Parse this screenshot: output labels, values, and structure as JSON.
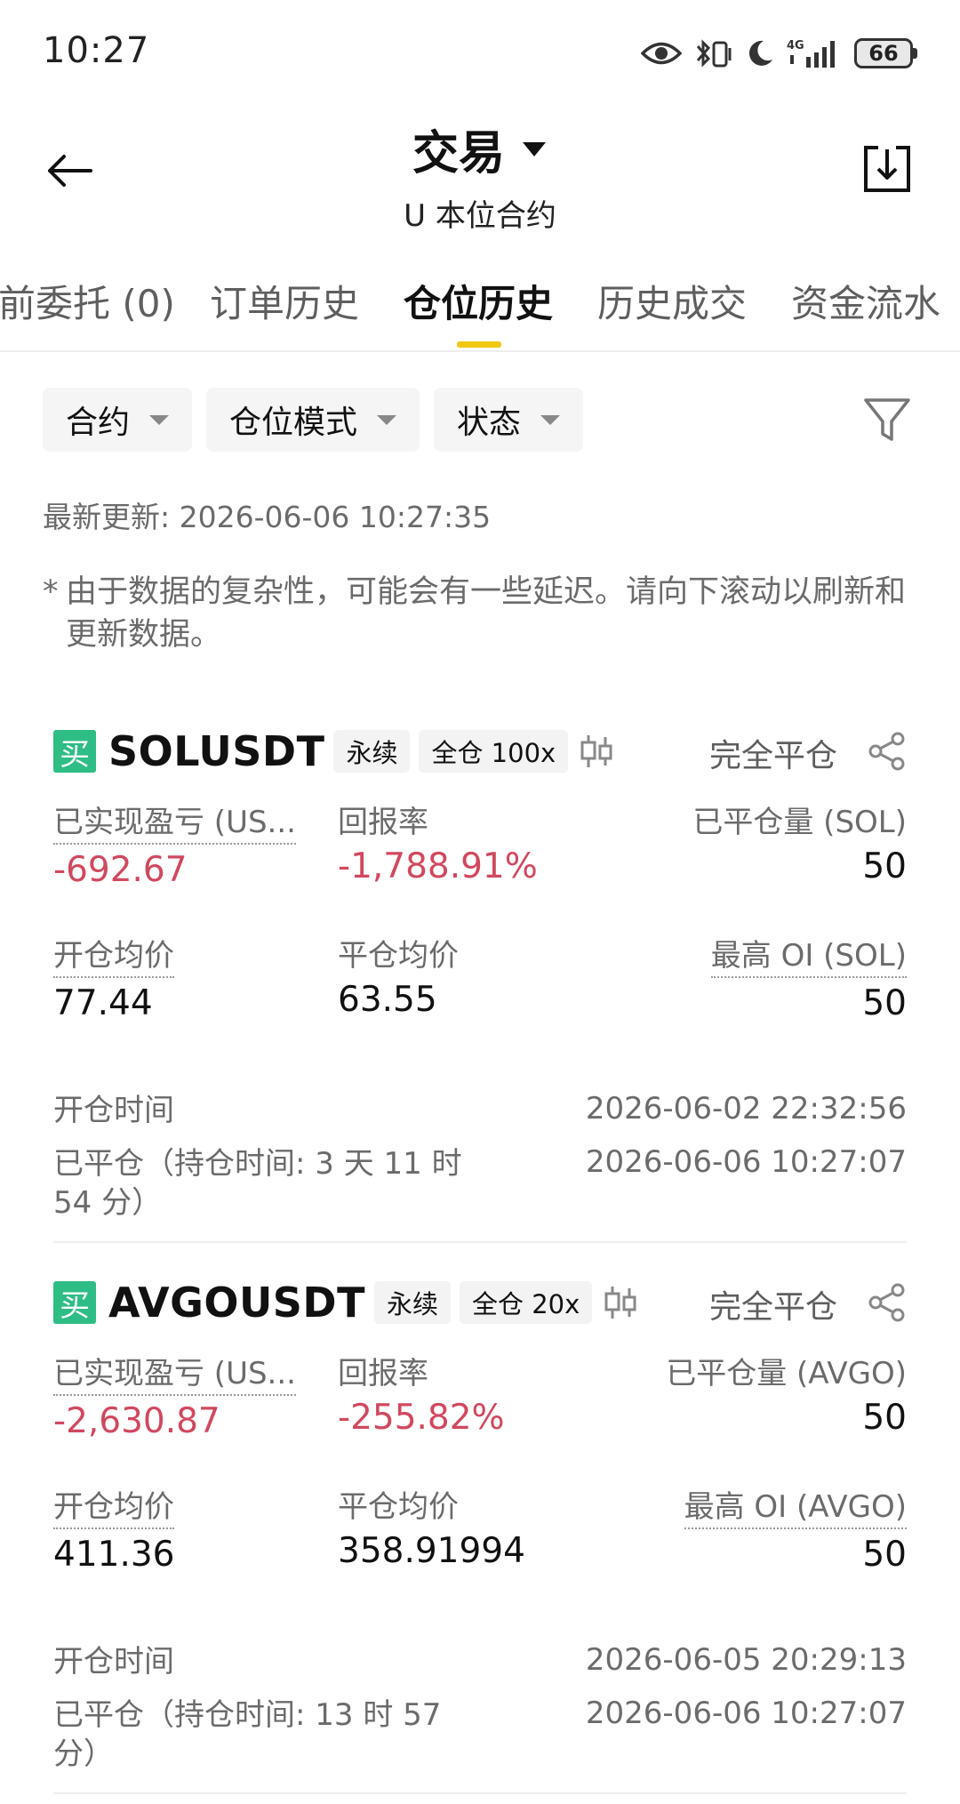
{
  "status_bar": {
    "time": "10:27",
    "network": "4G",
    "battery": "66"
  },
  "header": {
    "title": "交易",
    "subtitle": "U 本位合约"
  },
  "tabs": [
    {
      "label": "前委托 (0)",
      "active": false
    },
    {
      "label": "订单历史",
      "active": false
    },
    {
      "label": "仓位历史",
      "active": true
    },
    {
      "label": "历史成交",
      "active": false
    },
    {
      "label": "资金流水",
      "active": false
    }
  ],
  "filters": {
    "contract": "合约",
    "position_mode": "仓位模式",
    "status": "状态"
  },
  "updated": "最新更新: 2026-06-06 10:27:35",
  "notice": {
    "star": "*",
    "text": "由于数据的复杂性，可能会有一些延迟。请向下滚动以刷新和更新数据。"
  },
  "positions": [
    {
      "side": "买",
      "symbol": "SOLUSDT",
      "type_tag": "永续",
      "margin_tag": "全仓 100x",
      "close_all": "完全平仓",
      "realized_pnl_label": "已实现盈亏 (US...",
      "realized_pnl": "-692.67",
      "roi_label": "回报率",
      "roi": "-1,788.91%",
      "closed_qty_label": "已平仓量 (SOL)",
      "closed_qty": "50",
      "entry_price_label": "开仓均价",
      "entry_price": "77.44",
      "close_price_label": "平仓均价",
      "close_price": "63.55",
      "max_oi_label": "最高 OI (SOL)",
      "max_oi": "50",
      "open_time_label": "开仓时间",
      "open_time": "2026-06-02 22:32:56",
      "closed_label_line1": "已平仓（持仓时间: 3 天 11 时",
      "closed_label_line2": "54 分）",
      "close_time": "2026-06-06 10:27:07"
    },
    {
      "side": "买",
      "symbol": "AVGOUSDT",
      "type_tag": "永续",
      "margin_tag": "全仓 20x",
      "close_all": "完全平仓",
      "realized_pnl_label": "已实现盈亏 (US...",
      "realized_pnl": "-2,630.87",
      "roi_label": "回报率",
      "roi": "-255.82%",
      "closed_qty_label": "已平仓量 (AVGO)",
      "closed_qty": "50",
      "entry_price_label": "开仓均价",
      "entry_price": "411.36",
      "close_price_label": "平仓均价",
      "close_price": "358.91994",
      "max_oi_label": "最高 OI (AVGO)",
      "max_oi": "50",
      "open_time_label": "开仓时间",
      "open_time": "2026-06-05 20:29:13",
      "closed_label_line1": "已平仓（持仓时间: 13 时 57",
      "closed_label_line2": "分）",
      "close_time": "2026-06-06 10:27:07"
    }
  ],
  "colors": {
    "accent": "#f0c812",
    "buy": "#2ebd85",
    "negative": "#d1485f"
  }
}
